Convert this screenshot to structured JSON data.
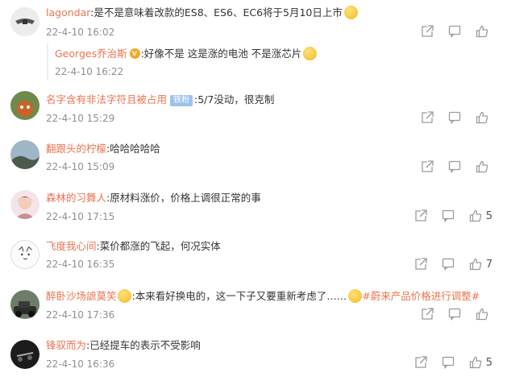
{
  "comments": [
    {
      "user": "lagondar",
      "text": ":是不是意味着改款的ES8、ES6、EC6将于5月10日上市",
      "time": "22-4-10 16:02",
      "likes": ""
    },
    {
      "user": "Georges乔治斯",
      "text": ":好像不是 这是涨的电池 不是涨芯片",
      "time": "22-4-10 16:22"
    },
    {
      "user": "名字含有非法字符且被占用",
      "badge": "铁粉",
      "text": ":5/7没动，很克制",
      "time": "22-4-10 15:29",
      "likes": ""
    },
    {
      "user": "翻跟头的柠檬",
      "text": ":哈哈哈哈哈",
      "time": "22-4-10 15:09",
      "likes": ""
    },
    {
      "user": "森林的习舞人",
      "text": ":原材料涨价，价格上调很正常的事",
      "time": "22-4-10 17:15",
      "likes": "5"
    },
    {
      "user": "飞度我心间",
      "text": ":菜价都涨的飞起，何况实体",
      "time": "22-4-10 16:35",
      "likes": "7"
    },
    {
      "user": "醉卧沙场謶莫笑",
      "text": ":本来看好换电的，这一下子又要重新考虑了……",
      "topic": "#蔚来产品价格进行调整#",
      "time": "22-4-10 17:36",
      "likes": ""
    },
    {
      "user": "锋驭而为",
      "text": ":已经提车的表示不受影响",
      "time": "22-4-10 16:36",
      "likes": "5"
    }
  ],
  "colors": {
    "username": "#eb7350",
    "time": "#8f8f8f",
    "icon": "#9a9a9a"
  },
  "icons": [
    "share-icon",
    "comment-icon",
    "like-icon"
  ]
}
